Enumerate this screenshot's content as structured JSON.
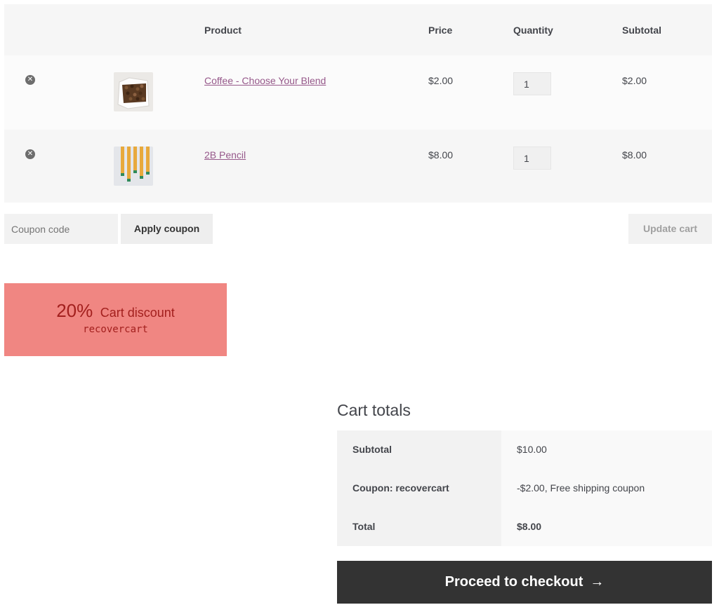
{
  "table": {
    "headers": {
      "product": "Product",
      "price": "Price",
      "quantity": "Quantity",
      "subtotal": "Subtotal"
    },
    "items": [
      {
        "name": "Coffee - Choose Your Blend",
        "price": "$2.00",
        "quantity": "1",
        "subtotal": "$2.00",
        "icon": "coffee-beans-bag"
      },
      {
        "name": "2B Pencil",
        "price": "$8.00",
        "quantity": "1",
        "subtotal": "$8.00",
        "icon": "pencils"
      }
    ]
  },
  "actions": {
    "coupon_placeholder": "Coupon code",
    "apply_label": "Apply coupon",
    "update_label": "Update cart"
  },
  "discount": {
    "percent": "20%",
    "label": "Cart discount",
    "code": "recovercart",
    "bg_color": "#f08682",
    "text_color": "#a3201e"
  },
  "totals": {
    "title": "Cart totals",
    "rows": [
      {
        "label": "Subtotal",
        "value": "$10.00"
      },
      {
        "label": "Coupon: recovercart",
        "value": "-$2.00, Free shipping coupon"
      },
      {
        "label": "Total",
        "value": "$8.00"
      }
    ]
  },
  "checkout": {
    "label": "Proceed to checkout",
    "arrow": "→"
  },
  "colors": {
    "link": "#96588a",
    "checkout_bg": "#333333"
  }
}
